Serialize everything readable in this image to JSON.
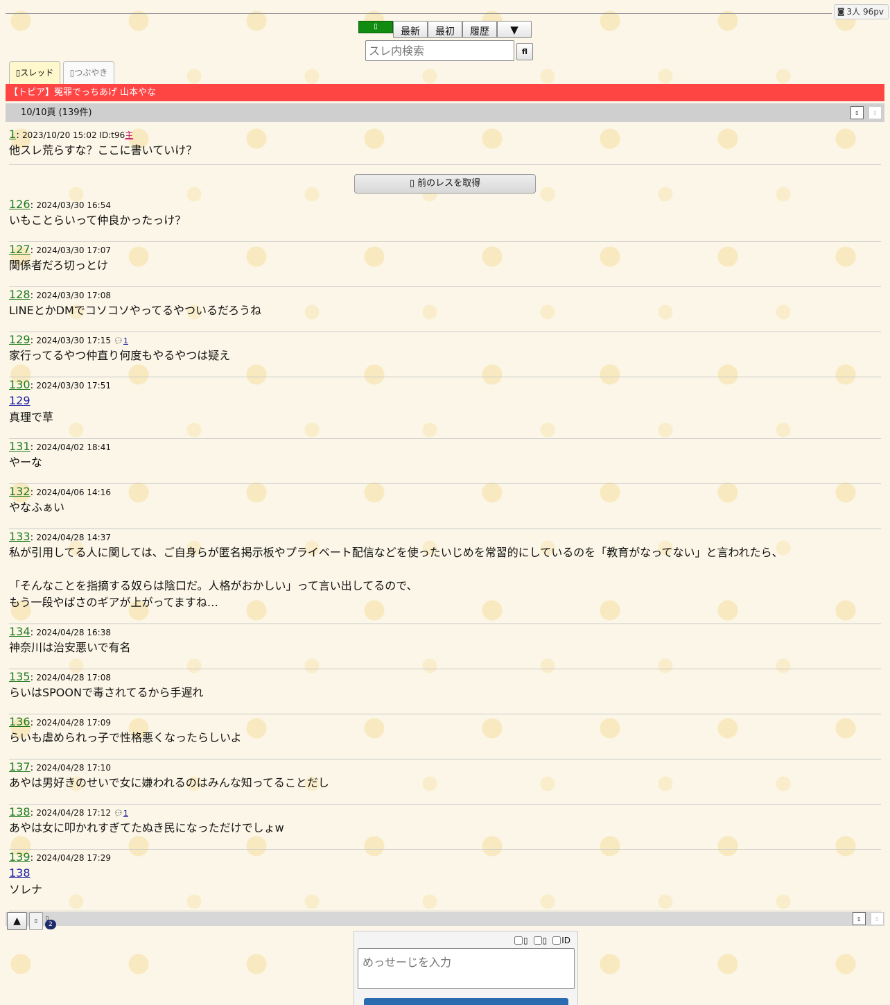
{
  "viewers": {
    "icon": "viewer-icon",
    "text": "3人 96pv"
  },
  "nav": {
    "green_label": "",
    "latest": "最新",
    "first": "最初",
    "history": "履歴",
    "menu": "▼"
  },
  "search": {
    "placeholder": "スレ内検索",
    "button": "fl"
  },
  "tabs": {
    "thread": "スレッド",
    "tweet": "つぶやき"
  },
  "thread_title": "【トピア】冤罪でっちあげ 山本やな",
  "page_info": "10/10頁 (139件)",
  "prev_button": "前のレスを取得",
  "first_post": {
    "num": "1",
    "date": "2023/10/20 15:02 ID:t96",
    "owner": "主",
    "body": "他スレ荒らすな？ここに書いていけ？"
  },
  "posts": [
    {
      "num": "126",
      "date": "2024/03/30 16:54",
      "body": "いもことらいって仲良かったっけ？"
    },
    {
      "num": "127",
      "date": "2024/03/30 17:07",
      "body": "関係者だろ切っとけ"
    },
    {
      "num": "128",
      "date": "2024/03/30 17:08",
      "body": "LINEとかDMでコソコソやってるやついるだろうね"
    },
    {
      "num": "129",
      "date": "2024/03/30 17:15",
      "replies": "1",
      "body": "家行ってるやつ仲直り何度もやるやつは疑え"
    },
    {
      "num": "130",
      "date": "2024/03/30 17:51",
      "anchor": "129",
      "body": "真理で草"
    },
    {
      "num": "131",
      "date": "2024/04/02 18:41",
      "body": "やーな"
    },
    {
      "num": "132",
      "date": "2024/04/06 14:16",
      "body": "やなふぁい"
    },
    {
      "num": "133",
      "date": "2024/04/28 14:37",
      "body": "私が引用してる人に関しては、ご自身らが匿名掲示板やプライベート配信などを使ったいじめを常習的にしているのを「教育がなってない」と言われたら、\n\n「そんなことを指摘する奴らは陰口だ。人格がおかしい」って言い出してるので、\nもう一段やばさのギアが上がってますね…"
    },
    {
      "num": "134",
      "date": "2024/04/28 16:38",
      "body": "神奈川は治安悪いで有名"
    },
    {
      "num": "135",
      "date": "2024/04/28 17:08",
      "body": "らいはSPOONで毒されてるから手遅れ"
    },
    {
      "num": "136",
      "date": "2024/04/28 17:09",
      "body": "らいも虐められっ子で性格悪くなったらしいよ"
    },
    {
      "num": "137",
      "date": "2024/04/28 17:10",
      "body": "あやは男好きのせいで女に嫌われるのはみんな知ってることだし"
    },
    {
      "num": "138",
      "date": "2024/04/28 17:12",
      "replies": "1",
      "body": "あやは女に叩かれすぎてたぬき民になっただけでしょw"
    },
    {
      "num": "139",
      "date": "2024/04/28 17:29",
      "anchor": "138",
      "body": "ソレナ"
    }
  ],
  "bottom": {
    "up": "▲",
    "badge": "2"
  },
  "form": {
    "opt3_label": "ID",
    "message_placeholder": "めっせーじを入力"
  },
  "colors": {
    "title_bar": "#ff4444",
    "post_number": "#1d7a1d",
    "anchor": "#1a1aa8",
    "page_bar": "#cfcfcf"
  }
}
